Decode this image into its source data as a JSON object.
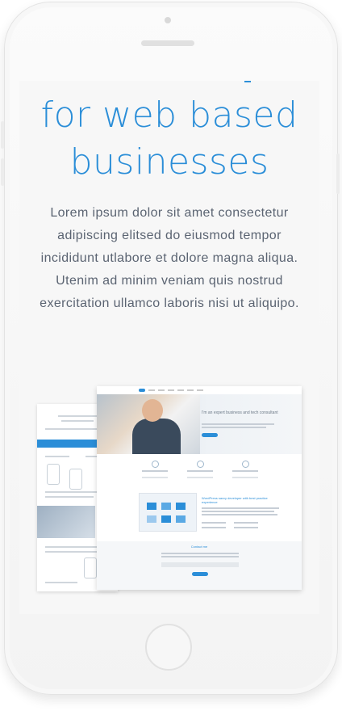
{
  "hero": {
    "title_line1": "for web based",
    "title_line2": "businesses",
    "body": "Lorem ipsum dolor sit amet consectetur adipiscing elitsed do eiusmod tempor incididunt utlabore et dolore magna aliqua. Utenim ad minim veniam quis nostrud exercitation ullamco laboris nisi ut aliquipo."
  },
  "mockup": {
    "hero_heading": "I'm an expert business and tech consultant",
    "section_heading": "WordPress savvy developer with best practice experience",
    "contact_heading": "Contact me"
  },
  "colors": {
    "accent": "#2b8ed8",
    "body_text": "#5b6472",
    "screen_bg": "#f7f7f7"
  }
}
